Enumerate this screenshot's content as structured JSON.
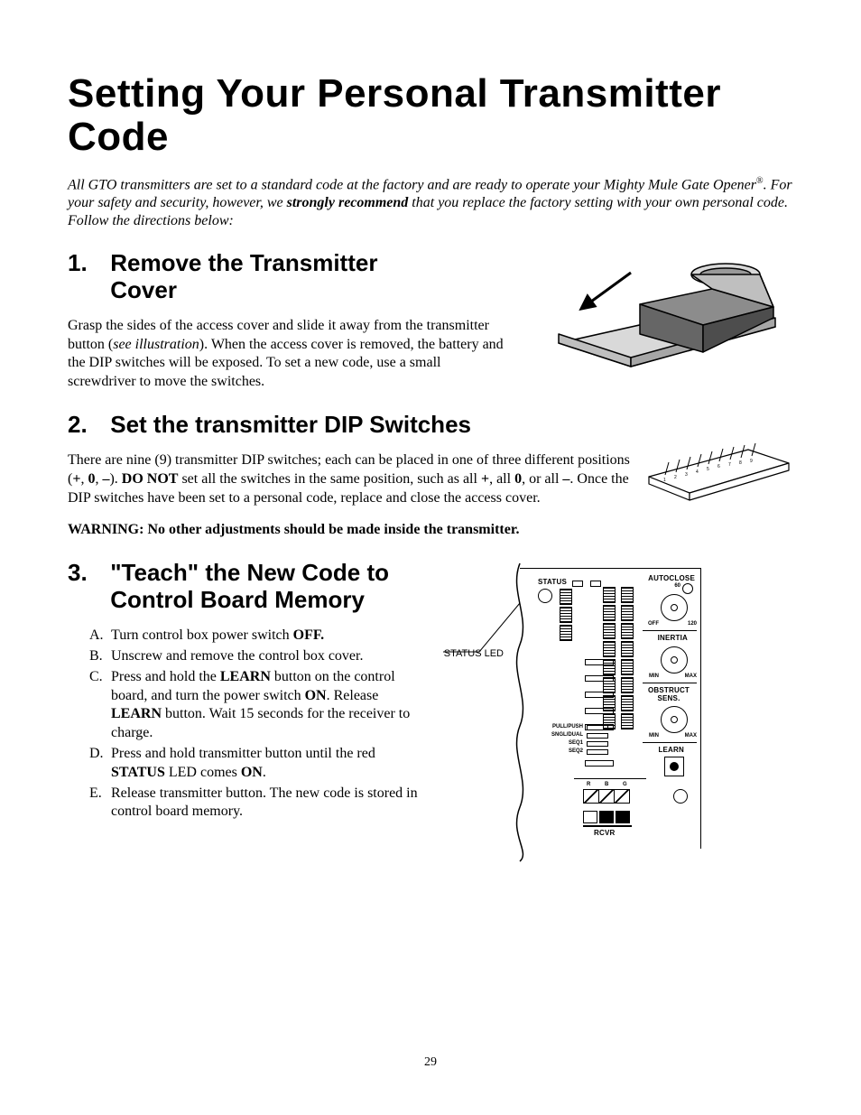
{
  "title": "Setting Your Personal Transmitter Code",
  "intro": {
    "t1": "All GTO transmitters are set to a standard code at the factory and are ready to operate your Mighty Mule Gate Opener",
    "reg": "®",
    "t2": ". For your safety and security, however, we ",
    "strong": "strongly recommend",
    "t3": " that you replace the factory setting with your own personal code.  Follow the directions below:"
  },
  "sec1": {
    "num": "1.",
    "title_l1": "Remove the Transmitter",
    "title_l2": "Cover",
    "p_a": "Grasp the sides of the access cover and slide it away from the transmitter button (",
    "p_i": "see illustration",
    "p_b": ").  When the access cover is removed, the battery and the DIP switches will be exposed.  To set a new code, use a small screwdriver to move the switches."
  },
  "sec2": {
    "num": "2.",
    "title": "Set the transmitter DIP Switches",
    "p_a": "There are nine (9) transmitter DIP switches; each can be placed in one of three different positions (",
    "plus": "+",
    "c1": ", ",
    "zero": "0",
    "c2": ", ",
    "minus": "–",
    "p_b": ").  ",
    "donot": "DO NOT",
    "p_c": " set all the switches in the same position, such as all ",
    "p_d": ", all ",
    "p_e": ", or all ",
    "p_f": ".  Once the DIP switches have been set to a personal code, replace and close the access cover.",
    "warn": "WARNING: No other adjustments should be made inside the transmitter."
  },
  "sec3": {
    "num": "3.",
    "title_l1": "\"Teach\" the New Code to",
    "title_l2": "Control Board Memory",
    "steps": [
      {
        "l": "A.",
        "a": "Turn control box power switch ",
        "b": "OFF.",
        "c": ""
      },
      {
        "l": "B.",
        "a": "Unscrew and remove the control box cover.",
        "b": "",
        "c": ""
      },
      {
        "l": "C.",
        "a": "Press and hold the ",
        "b": "LEARN",
        "c": " button on the control board, and turn the power switch ",
        "b2": "ON",
        "c2": ".  Release ",
        "b3": "LEARN",
        "c3": " button. Wait 15 seconds for the receiver to charge."
      },
      {
        "l": "D.",
        "a": "Press and hold transmitter button until the red ",
        "b": "STATUS",
        "c": " LED comes ",
        "b2": "ON",
        "c2": "."
      },
      {
        "l": "E.",
        "a": "Release transmitter button.  The new code is stored in control board memory.",
        "b": "",
        "c": ""
      }
    ]
  },
  "callout": "STATUS LED",
  "board": {
    "status": "STATUS",
    "autoclose": "AUTOCLOSE",
    "off": "OFF",
    "n60": "60",
    "n120": "120",
    "inertia": "INERTIA",
    "min": "MIN",
    "max": "MAX",
    "obstruct": "OBSTRUCT SENS.",
    "learn": "LEARN",
    "pullpush": "PULL/PUSH",
    "sngldual": "SNGL/DUAL",
    "seq1": "SEQ1",
    "seq2": "SEQ2",
    "rcvr": "RCVR",
    "rbg_r": "R",
    "rbg_b": "B",
    "rbg_g": "G"
  },
  "page": "29"
}
